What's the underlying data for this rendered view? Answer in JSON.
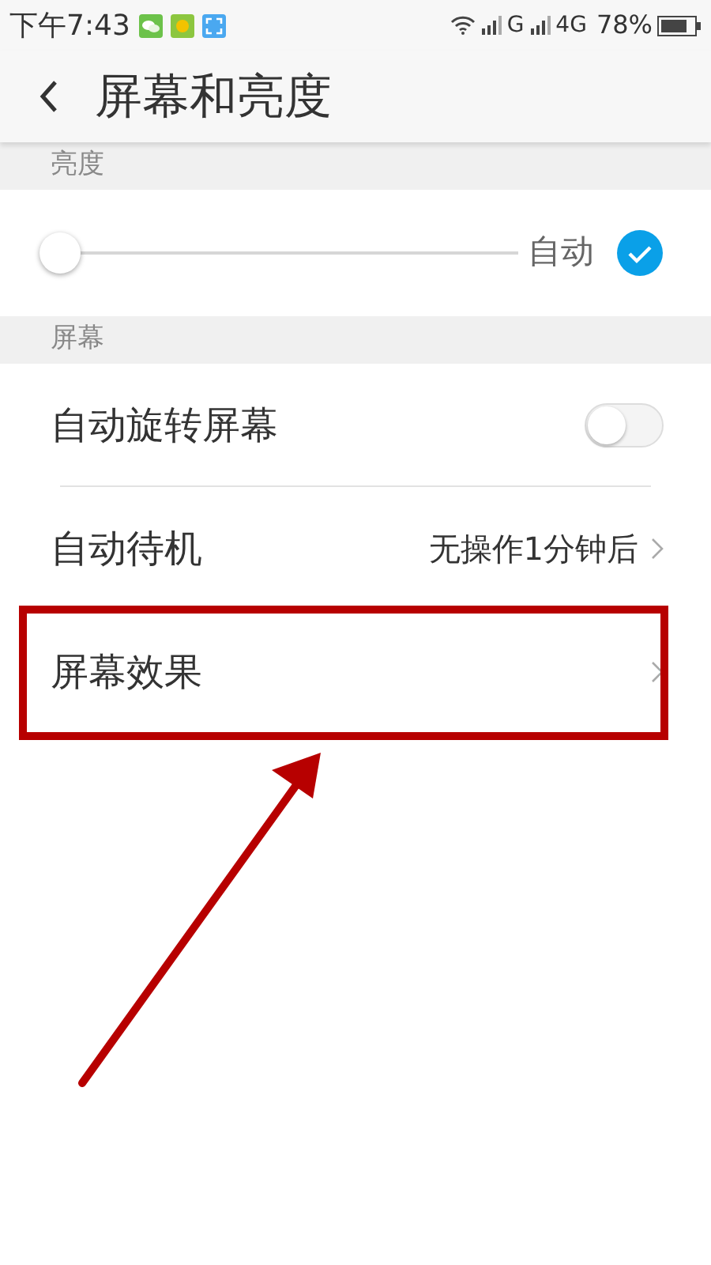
{
  "status_bar": {
    "time": "下午7:43",
    "network_1": "G",
    "network_2": "4G",
    "battery": "78%"
  },
  "header": {
    "title": "屏幕和亮度"
  },
  "sections": [
    {
      "title": "亮度",
      "rows": [
        {
          "kind": "slider",
          "level": 0,
          "label": "自动",
          "checked": true
        }
      ]
    },
    {
      "title": "屏幕",
      "rows": [
        {
          "kind": "switch",
          "label": "自动旋转屏幕",
          "on": false
        },
        {
          "kind": "link",
          "label": "自动待机",
          "value": "无操作1分钟后",
          "highlighted": false
        },
        {
          "kind": "link",
          "label": "屏幕效果",
          "highlighted": true
        }
      ]
    }
  ]
}
